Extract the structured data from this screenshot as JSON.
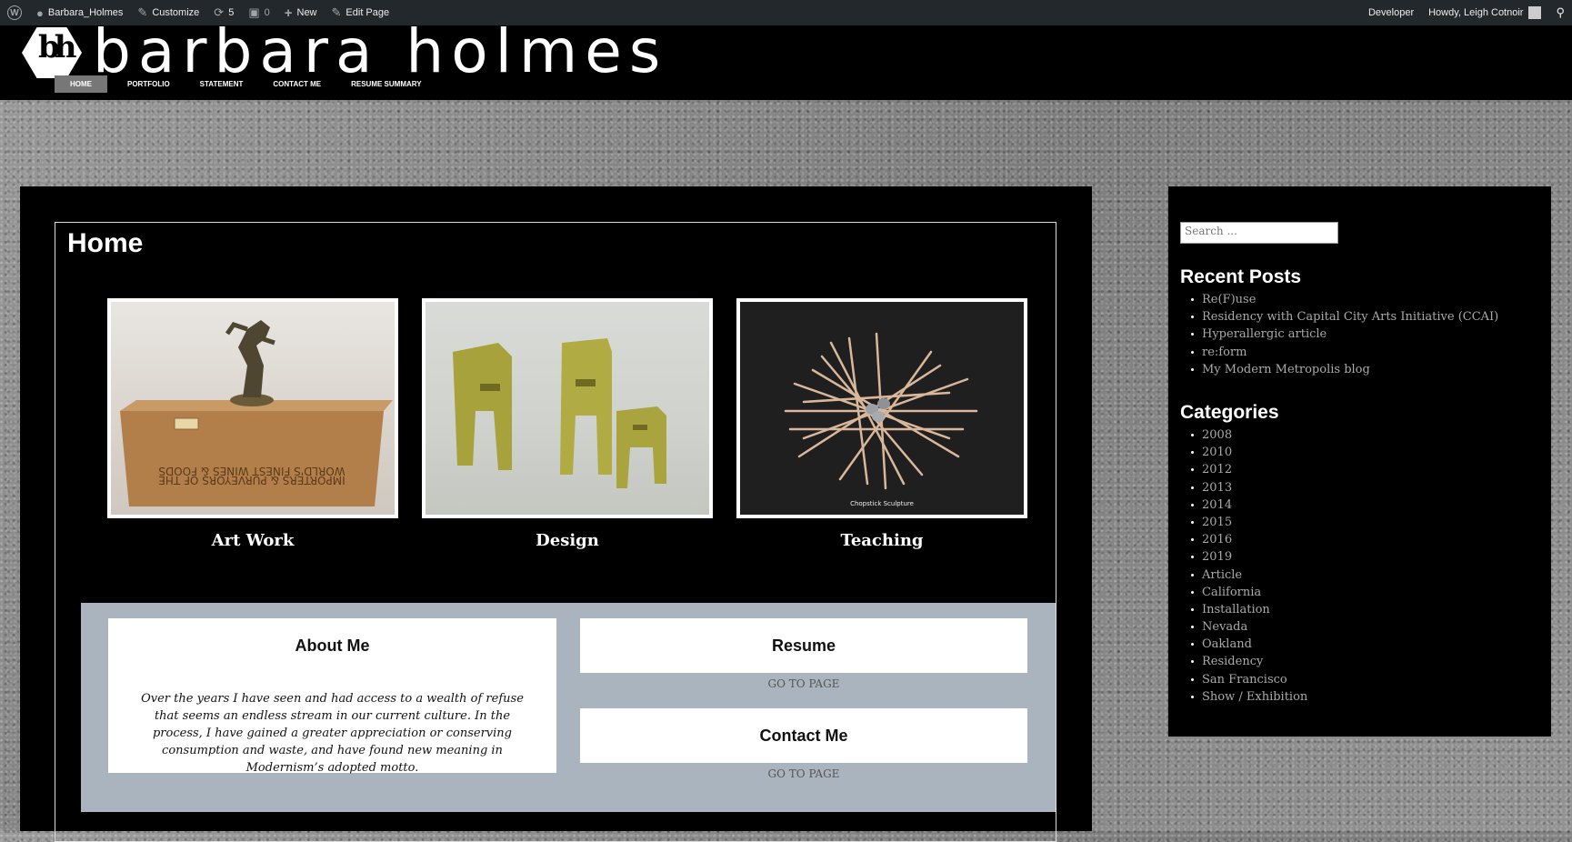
{
  "adminbar": {
    "site_name": "Barbara_Holmes",
    "customize": "Customize",
    "updates_count": "5",
    "comments_count": "0",
    "new_label": "New",
    "edit_page": "Edit Page",
    "developer": "Developer",
    "howdy": "Howdy, Leigh Cotnoir"
  },
  "header": {
    "logo_mark": "bh",
    "site_title": "barbara holmes",
    "nav": [
      "HOME",
      "PORTFOLIO",
      "STATEMENT",
      "CONTACT ME",
      "RESUME SUMMARY"
    ]
  },
  "main": {
    "page_title": "Home",
    "features": [
      {
        "label": "Art Work"
      },
      {
        "label": "Design"
      },
      {
        "label": "Teaching"
      }
    ],
    "teaching_caption": "Chopstick Sculpture",
    "crate_text_1": "IMPORTERS & PURVEYORS OF THE",
    "crate_text_2": "WORLD'S FINEST WINES & FOODS",
    "about": {
      "title": "About Me",
      "text": "Over the years I have seen and had access to a wealth of refuse that seems an endless stream in our current culture. In the process, I have gained a greater appreciation or conserving consumption and waste, and have found new meaning in Modernism’s adopted motto."
    },
    "resume": {
      "title": "Resume",
      "link": "GO TO PAGE"
    },
    "contact": {
      "title": "Contact Me",
      "link": "GO TO PAGE"
    }
  },
  "sidebar": {
    "search_placeholder": "Search ...",
    "recent_posts_title": "Recent Posts",
    "recent_posts": [
      "Re(F)use",
      "Residency with Capital City Arts Initiative (CCAI)",
      "Hyperallergic article",
      "re:form",
      "My Modern Metropolis blog"
    ],
    "categories_title": "Categories",
    "categories": [
      "2008",
      "2010",
      "2012",
      "2013",
      "2014",
      "2015",
      "2016",
      "2019",
      "Article",
      "California",
      "Installation",
      "Nevada",
      "Oakland",
      "Residency",
      "San Francisco",
      "Show / Exhibition"
    ]
  }
}
